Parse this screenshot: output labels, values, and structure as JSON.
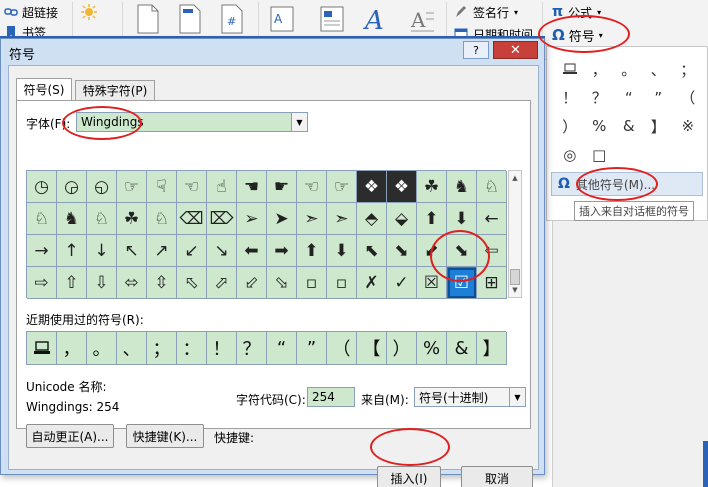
{
  "ribbon": {
    "hyperlink": "超链接",
    "bookmark": "书签",
    "signature_line": "签名行",
    "date_time": "日期和时间",
    "equation": "公式",
    "symbol": "符号"
  },
  "symbol_dropdown": {
    "symbols": [
      "",
      "，",
      "。",
      "、",
      "；",
      "：",
      "！",
      "？",
      "“",
      "”",
      "（",
      "【",
      "）",
      "%",
      "&",
      "】",
      "※",
      "○",
      "◎",
      "□"
    ],
    "more_symbols": "其他符号(M)...",
    "tooltip": "插入来自对话框的符号"
  },
  "dialog": {
    "title": "符号",
    "help": "?",
    "close": "✕",
    "tabs": [
      "符号(S)",
      "特殊字符(P)"
    ],
    "font_label": "字体(F):",
    "font_value": "Wingdings",
    "grid": [
      [
        "◷",
        "◶",
        "◵",
        "☞",
        "☟",
        "☜",
        "☝",
        "☚",
        "☛",
        "☜",
        "☞",
        "❖",
        "❖",
        "☘",
        "♞",
        "♘"
      ],
      [
        "♘",
        "♞",
        "♘",
        "☘",
        "♘",
        "⌫",
        "⌦",
        "➢",
        "➤",
        "➣",
        "➣",
        "⬘",
        "⬙",
        "⬆",
        "⬇",
        "←"
      ],
      [
        "→",
        "↑",
        "↓",
        "↖",
        "↗",
        "↙",
        "↘",
        "⬅",
        "➡",
        "⬆",
        "⬇",
        "⬉",
        "⬊",
        "⬋",
        "⬊",
        "⇦"
      ],
      [
        "⇨",
        "⇧",
        "⇩",
        "⬄",
        "⇳",
        "⬁",
        "⬀",
        "⬃",
        "⬂",
        "▫",
        "▫",
        "✗",
        "✓",
        "☒",
        "☑",
        "⊞"
      ]
    ],
    "recent_label": "近期使用过的符号(R):",
    "recent": [
      "",
      "，",
      "。",
      "、",
      "；",
      "：",
      "！",
      "？",
      "“",
      "”",
      "（",
      "【",
      "）",
      "%",
      "&",
      "】"
    ],
    "unicode_name_label": "Unicode 名称:",
    "unicode_name_value": "Wingdings: 254",
    "char_code_label": "字符代码(C):",
    "char_code_value": "254",
    "from_label": "来自(M):",
    "from_value": "符号(十进制)",
    "autocorrect_button": "自动更正(A)...",
    "shortcut_key_button": "快捷键(K)...",
    "shortcut_label": "快捷键:",
    "insert_button": "插入(I)",
    "cancel_button": "取消"
  },
  "colors": {
    "accent_blue": "#1e7fd6",
    "cell_green": "#cde8cd",
    "annotation_red": "#e02020"
  }
}
